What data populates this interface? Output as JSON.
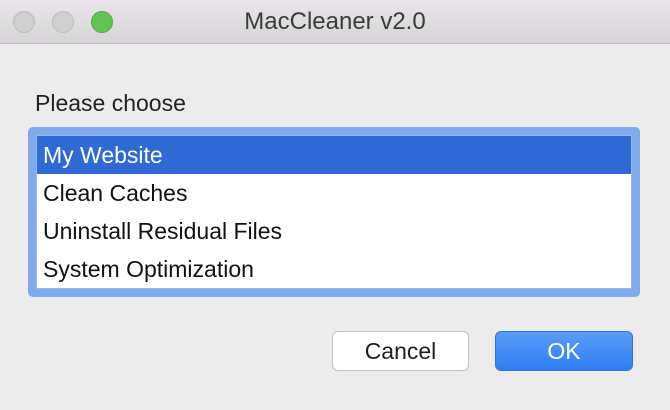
{
  "window": {
    "title": "MacCleaner v2.0"
  },
  "dialog": {
    "prompt": "Please choose",
    "items": [
      {
        "label": "My Website",
        "selected": true
      },
      {
        "label": "Clean Caches",
        "selected": false
      },
      {
        "label": "Uninstall Residual Files",
        "selected": false
      },
      {
        "label": "System Optimization",
        "selected": false
      }
    ],
    "cancel_label": "Cancel",
    "ok_label": "OK"
  },
  "colors": {
    "selection": "#2f6ad4",
    "focus_ring": "#7faaf0",
    "ok_button": "#2f7ef2",
    "zoom_button": "#61c554"
  }
}
